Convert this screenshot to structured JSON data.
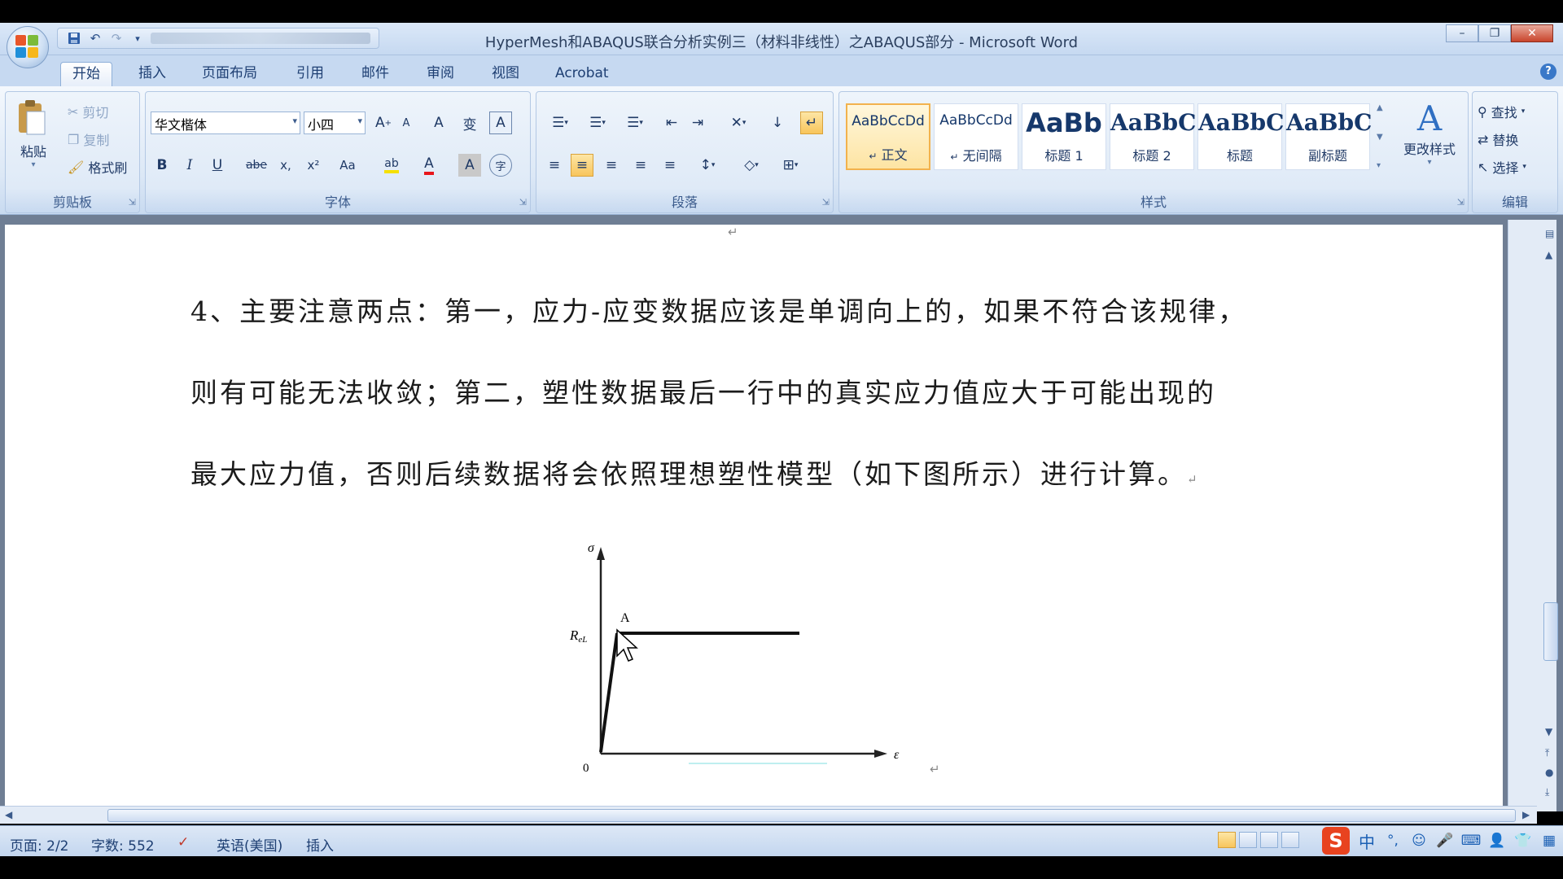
{
  "window": {
    "title": "HyperMesh和ABAQUS联合分析实例三（材料非线性）之ABAQUS部分 - Microsoft Word",
    "minimize": "–",
    "restore": "❐",
    "close": "✕"
  },
  "qat": {
    "save": "💾",
    "undo": "↶",
    "redo": "↷",
    "more": "▾"
  },
  "tabs": [
    "开始",
    "插入",
    "页面布局",
    "引用",
    "邮件",
    "审阅",
    "视图",
    "Acrobat"
  ],
  "help": "?",
  "clipboard": {
    "label": "剪贴板",
    "paste": "粘贴",
    "cut": "剪切",
    "copy": "复制",
    "format_painter": "格式刷"
  },
  "font": {
    "label": "字体",
    "name": "华文楷体",
    "size": "小四",
    "grow": "A",
    "shrink": "A",
    "clear": "A",
    "phonetic": "变",
    "border_char": "A",
    "bold": "B",
    "italic": "I",
    "underline": "U",
    "strike": "abe",
    "subscript": "x,",
    "superscript": "x²",
    "case": "Aa",
    "highlight": "ab",
    "color": "A",
    "shade": "A",
    "enclose": "字"
  },
  "paragraph": {
    "label": "段落",
    "bullets": "☰",
    "numbering": "☰",
    "multilevel": "☰",
    "decrease_indent": "⇤",
    "increase_indent": "⇥",
    "chinese_layout": "✕",
    "sort": "↓",
    "show_marks": "↵",
    "align_left": "≡",
    "align_center": "≡",
    "align_right": "≡",
    "justify": "≡",
    "distributed": "≡",
    "line_spacing": "↕",
    "shading": "◇",
    "borders": "⊞"
  },
  "styles": {
    "label": "样式",
    "items": [
      {
        "sample": "AaBbCcDd",
        "name": "正文",
        "mark": "↵"
      },
      {
        "sample": "AaBbCcDd",
        "name": "无间隔",
        "mark": "↵"
      },
      {
        "sample": "AaBb",
        "name": "标题 1",
        "mark": ""
      },
      {
        "sample": "AaBbC",
        "name": "标题 2",
        "mark": ""
      },
      {
        "sample": "AaBbC",
        "name": "标题",
        "mark": ""
      },
      {
        "sample": "AaBbC",
        "name": "副标题",
        "mark": ""
      }
    ],
    "change_styles": "更改样式",
    "change_icon": "A"
  },
  "editing": {
    "label": "编辑",
    "find": "查找",
    "replace": "替换",
    "select": "选择"
  },
  "document": {
    "line1": "4、主要注意两点：第一，应力-应变数据应该是单调向上的，如果不符合该规律，",
    "line2": "则有可能无法收敛；第二，塑性数据最后一行中的真实应力值应大于可能出现的",
    "line3": "最大应力值，否则后续数据将会依照理想塑性模型（如下图所示）进行计算。",
    "para_mark": "↵",
    "figure": {
      "y_axis": "σ",
      "x_axis": "ε",
      "point": "A",
      "y_label": "R",
      "y_label_sub": "eL",
      "origin": "0"
    }
  },
  "status": {
    "page": "页面: 2/2",
    "words": "字数: 552",
    "language": "英语(美国)",
    "mode": "插入"
  },
  "tray": {
    "ime": "S",
    "lang": "中"
  }
}
